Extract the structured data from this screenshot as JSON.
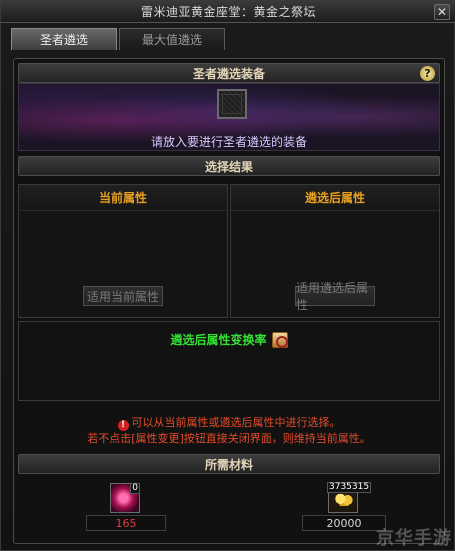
{
  "window": {
    "title": "雷米迪亚黄金座堂：黄金之祭坛",
    "close_glyph": "✕"
  },
  "tabs": [
    {
      "label": "圣者遴选",
      "active": true
    },
    {
      "label": "最大值遴选",
      "active": false
    }
  ],
  "equip_section": {
    "title": "圣者遴选装备",
    "hint": "请放入要进行圣者遴选的装备",
    "help_glyph": "?"
  },
  "result_section": {
    "title": "选择结果",
    "current": {
      "title": "当前属性",
      "button": "适用当前属性"
    },
    "after": {
      "title": "遴选后属性",
      "button": "适用遴选后属性"
    }
  },
  "rate": {
    "title": "遴选后属性变换率"
  },
  "warning": {
    "icon_glyph": "!",
    "line1": "可以从当前属性或遴选后属性中进行选择。",
    "line2": "若不点击[属性变更]按钮直接关闭界面，则维持当前属性。"
  },
  "materials": {
    "title": "所需材料",
    "items": [
      {
        "icon": "gem-icon",
        "badge": "0",
        "value": "165",
        "value_color": "#e23b3b"
      },
      {
        "icon": "gold-icon",
        "badge": "3735315",
        "value": "20000",
        "value_color": "#d8d8d8"
      }
    ]
  },
  "watermark": "京华手游"
}
